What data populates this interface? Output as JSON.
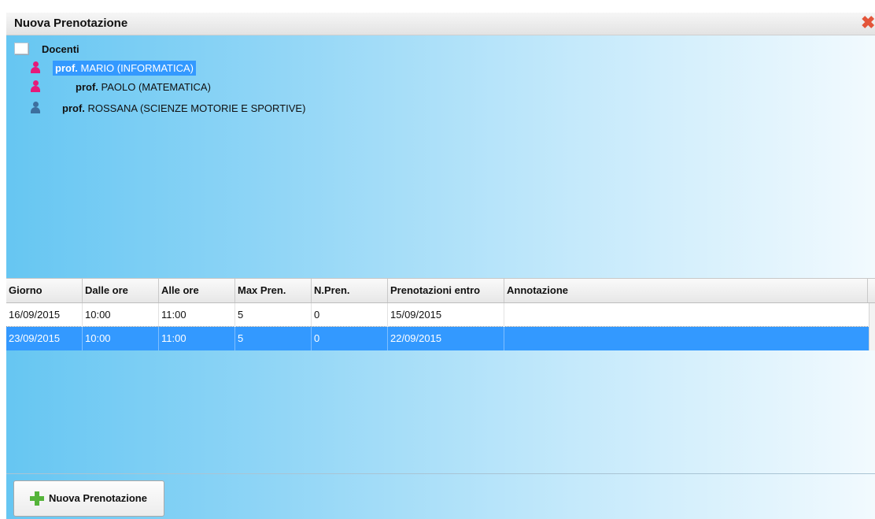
{
  "window": {
    "title": "Nuova Prenotazione",
    "close_icon": "close-icon"
  },
  "tree": {
    "root_label": "Docenti",
    "items": [
      {
        "prefix": "prof.",
        "name": "MARIO (INFORMATICA)",
        "icon": "female-teacher-icon",
        "selected": true
      },
      {
        "prefix": "prof.",
        "name": "PAOLO (MATEMATICA)",
        "icon": "female-teacher-icon",
        "selected": false
      },
      {
        "prefix": "prof.",
        "name": "ROSSANA (SCIENZE MOTORIE E SPORTIVE)",
        "icon": "male-teacher-icon",
        "selected": false
      }
    ]
  },
  "table": {
    "columns": [
      "Giorno",
      "Dalle ore",
      "Alle ore",
      "Max Pren.",
      "N.Pren.",
      "Prenotazioni entro",
      "Annotazione"
    ],
    "rows": [
      {
        "cells": [
          "16/09/2015",
          "10:00",
          "11:00",
          "5",
          "0",
          "15/09/2015",
          ""
        ],
        "selected": false
      },
      {
        "cells": [
          "23/09/2015",
          "10:00",
          "11:00",
          "5",
          "0",
          "22/09/2015",
          ""
        ],
        "selected": true
      }
    ]
  },
  "footer": {
    "new_booking_button": "Nuova Prenotazione",
    "new_booking_icon": "plus-icon"
  },
  "colors": {
    "selection": "#3399ff",
    "pink_icon": "#e51a7a",
    "blue_icon": "#3d6f9e",
    "plus_green": "#55b43a",
    "close_red": "#e3553a"
  }
}
